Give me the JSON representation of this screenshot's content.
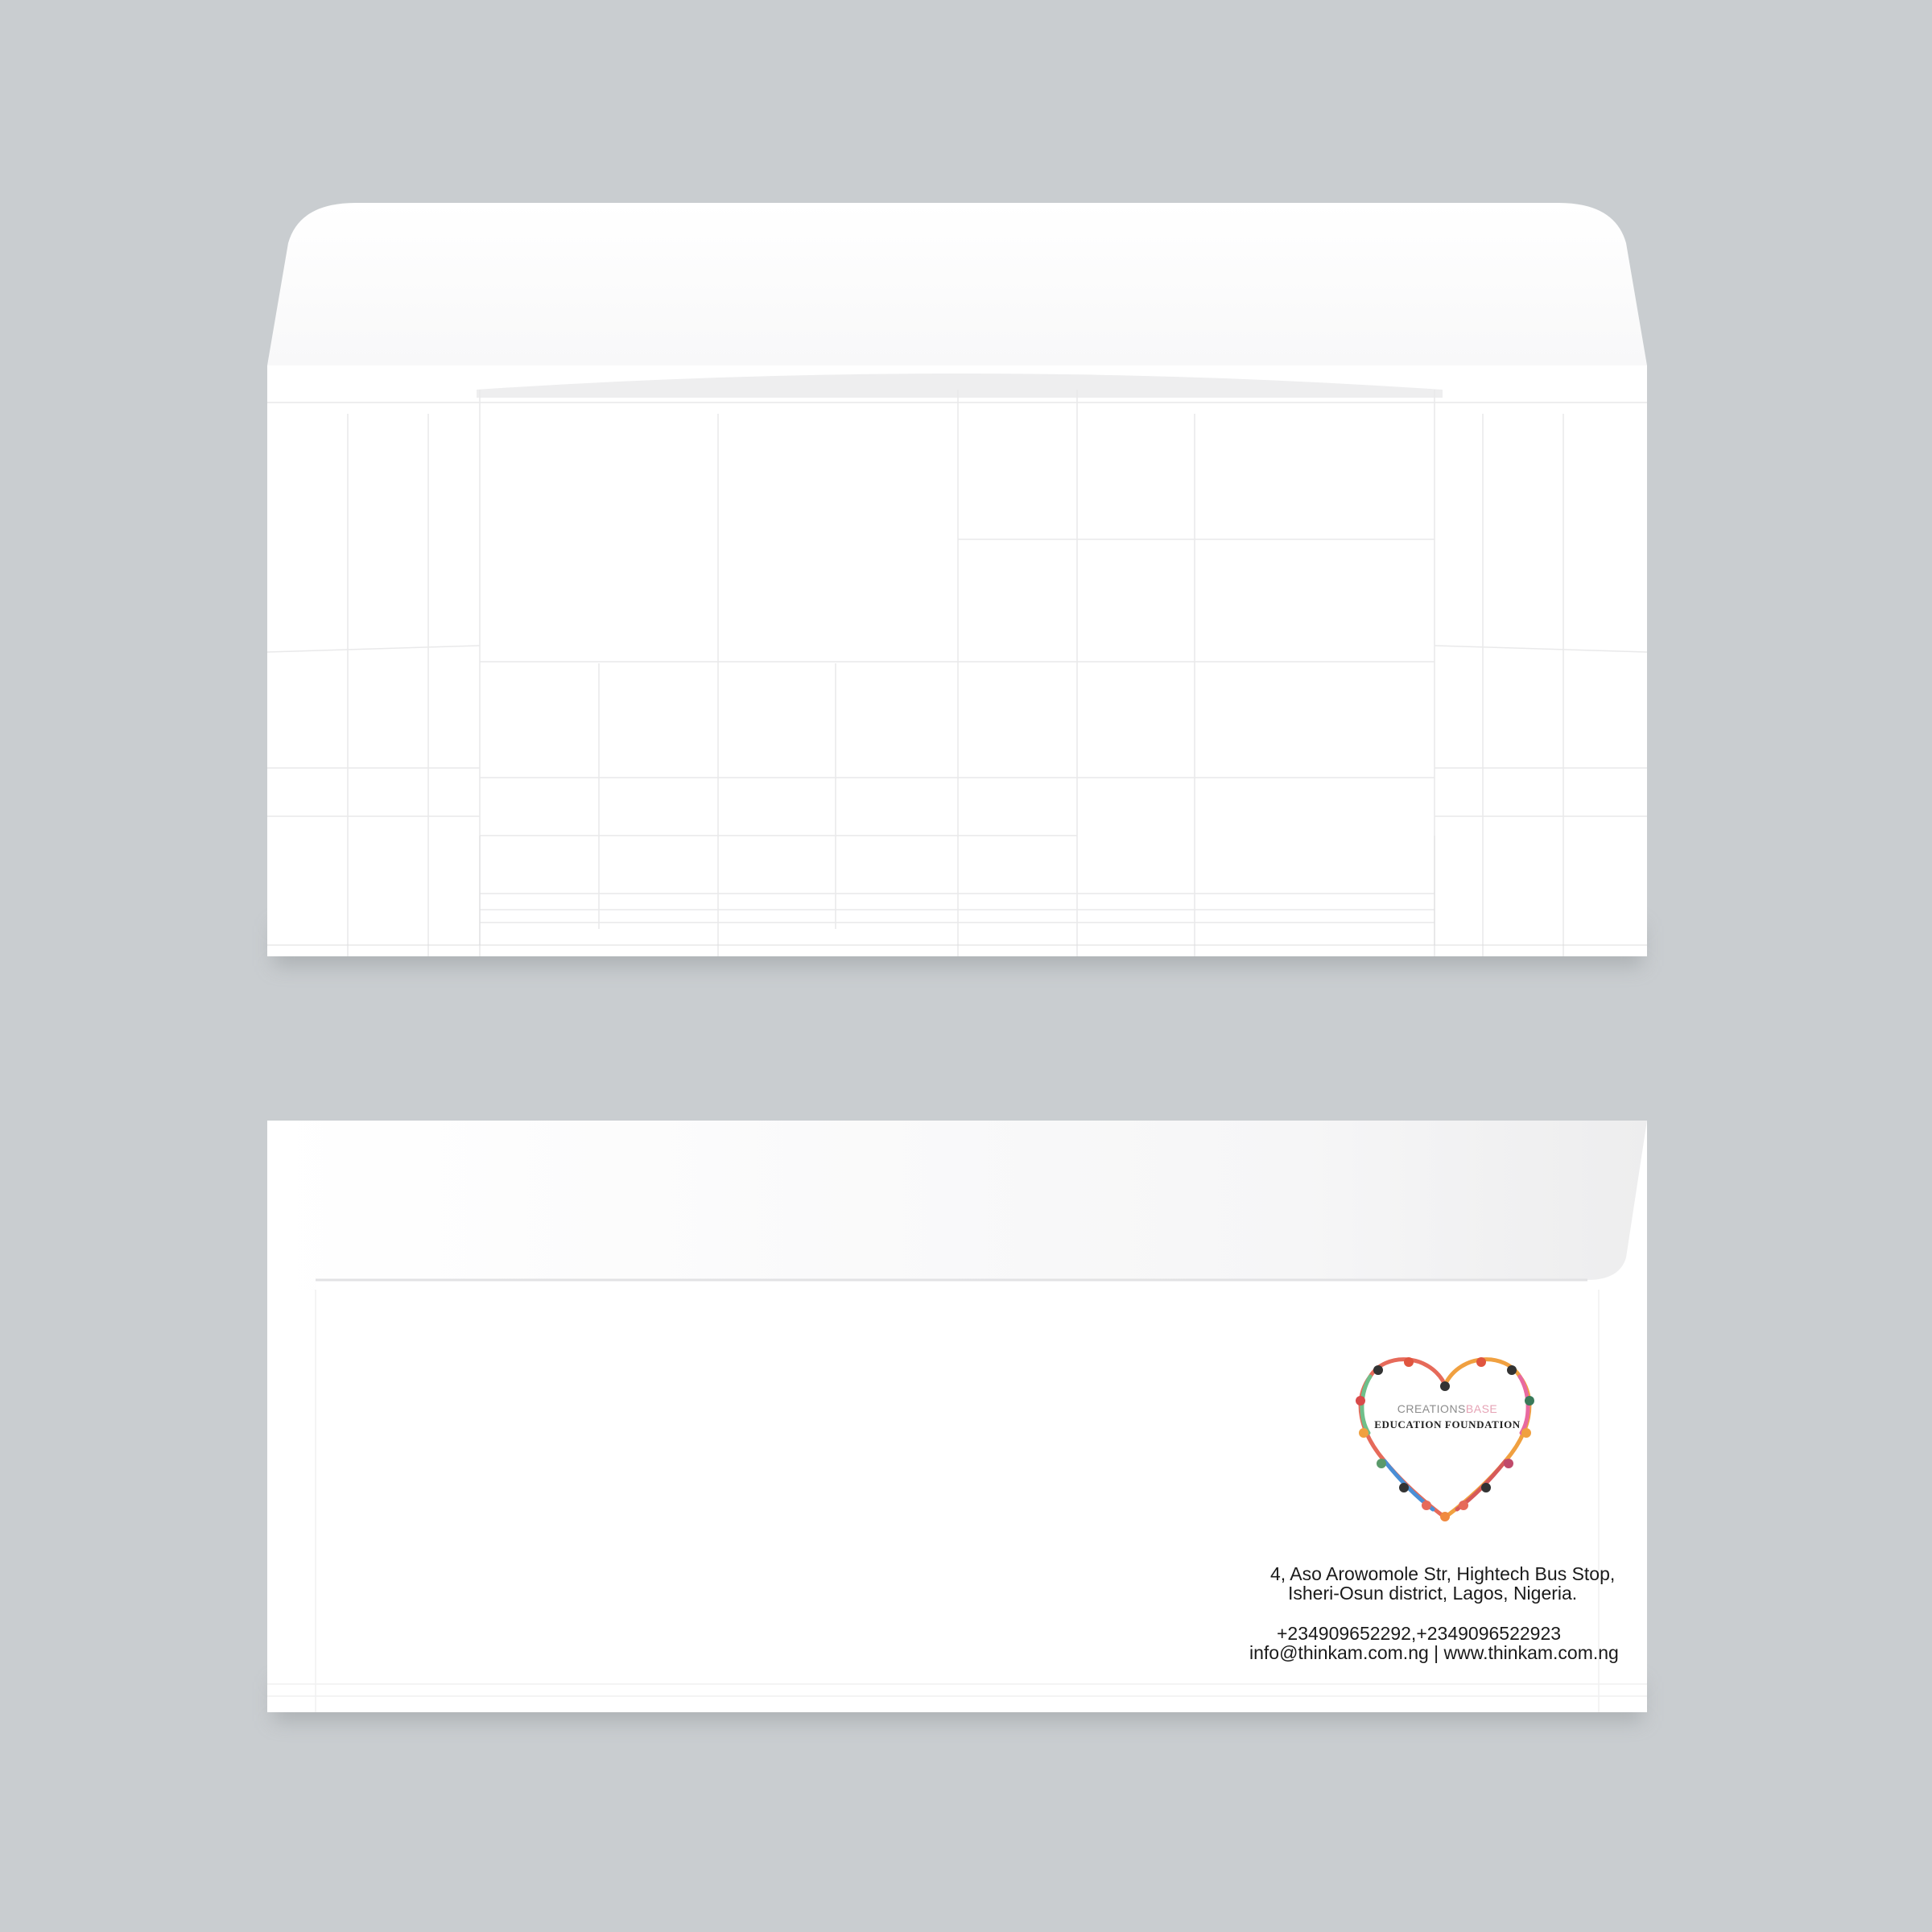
{
  "organization": {
    "name_part1": "CREATIONS",
    "name_part2": "BASE",
    "name_line2": "EDUCATION FOUNDATION"
  },
  "address": {
    "line1": "4, Aso Arowomole Str, Hightech Bus Stop,",
    "line2": "Isheri-Osun district, Lagos, Nigeria."
  },
  "contact": {
    "phones": "+234909652292,+2349096522923",
    "email_web": "info@thinkam.com.ng | www.thinkam.com.ng"
  },
  "colors": {
    "background": "#c9cdd0",
    "paper": "#ffffff"
  },
  "icons": {
    "logo": "heart-of-people-holding-hands-logo"
  }
}
